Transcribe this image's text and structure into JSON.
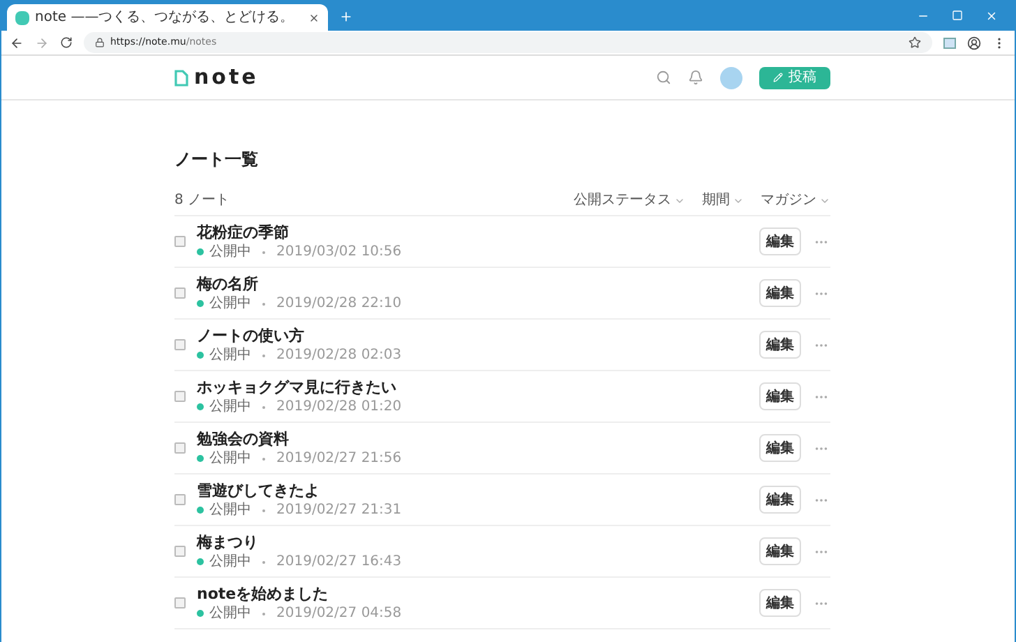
{
  "browser": {
    "tab_title": "note ——つくる、つながる、とどける。",
    "url_host": "https://note.mu",
    "url_path": "/notes"
  },
  "header": {
    "logo": "note",
    "post_button": "投稿"
  },
  "page": {
    "title": "ノート一覧",
    "count": "8 ノート",
    "filters": [
      "公開ステータス",
      "期間",
      "マガジン"
    ]
  },
  "notes": [
    {
      "title": "花粉症の季節",
      "status": "公開中",
      "color": "#2cc2a0",
      "date": "2019/03/02 10:56",
      "checked": false,
      "edit": "編集"
    },
    {
      "title": "梅の名所",
      "status": "公開中",
      "color": "#2cc2a0",
      "date": "2019/02/28 22:10",
      "checked": false,
      "edit": "編集"
    },
    {
      "title": "ノートの使い方",
      "status": "公開中",
      "color": "#2cc2a0",
      "date": "2019/02/28 02:03",
      "checked": false,
      "edit": "編集"
    },
    {
      "title": "ホッキョクグマ見に行きたい",
      "status": "公開中",
      "color": "#2cc2a0",
      "date": "2019/02/28 01:20",
      "checked": false,
      "edit": "編集"
    },
    {
      "title": "勉強会の資料",
      "status": "公開中",
      "color": "#2cc2a0",
      "date": "2019/02/27 21:56",
      "checked": false,
      "edit": "編集"
    },
    {
      "title": "雪遊びしてきたよ",
      "status": "公開中",
      "color": "#2cc2a0",
      "date": "2019/02/27 21:31",
      "checked": false,
      "edit": "編集"
    },
    {
      "title": "梅まつり",
      "status": "公開中",
      "color": "#2cc2a0",
      "date": "2019/02/27 16:43",
      "checked": false,
      "edit": "編集"
    },
    {
      "title": "noteを始めました",
      "status": "公開中",
      "color": "#2cc2a0",
      "date": "2019/02/27 04:58",
      "checked": false,
      "edit": "編集"
    }
  ]
}
